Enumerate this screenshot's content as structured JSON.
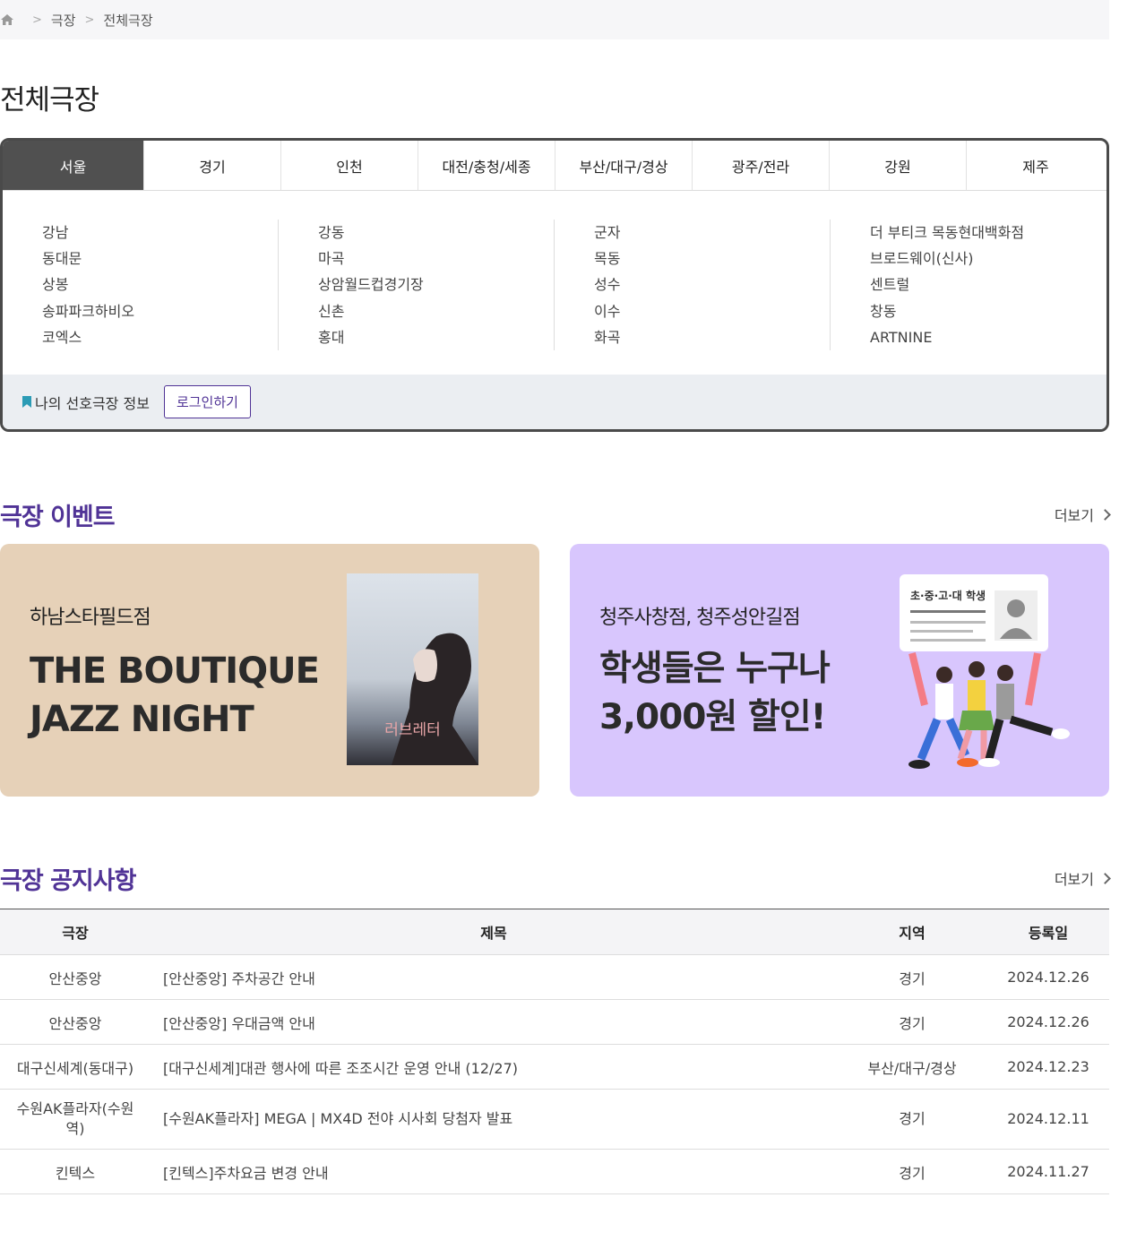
{
  "breadcrumb": {
    "items": [
      "극장",
      "전체극장"
    ]
  },
  "page_title": "전체극장",
  "regions": {
    "tabs": [
      "서울",
      "경기",
      "인천",
      "대전/충청/세종",
      "부산/대구/경상",
      "광주/전라",
      "강원",
      "제주"
    ],
    "active_tab": "서울",
    "branches": [
      [
        "강남",
        "동대문",
        "상봉",
        "송파파크하비오",
        "코엑스"
      ],
      [
        "강동",
        "마곡",
        "상암월드컵경기장",
        "신촌",
        "홍대"
      ],
      [
        "군자",
        "목동",
        "성수",
        "이수",
        "화곡"
      ],
      [
        "더 부티크 목동현대백화점",
        "브로드웨이(신사)",
        "센트럴",
        "창동",
        "ARTNINE"
      ]
    ]
  },
  "favorite": {
    "label": "나의 선호극장 정보",
    "login_button": "로그인하기"
  },
  "events": {
    "title": "극장 이벤트",
    "more": "더보기",
    "cards": [
      {
        "subtitle": "하남스타필드점",
        "headline": "THE BOUTIQUE\nJAZZ NIGHT",
        "poster_title": "러브레터"
      },
      {
        "subtitle": "청주사창점, 청주성안길점",
        "headline": "학생들은 누구나\n3,000원 할인!",
        "card_label": "초·중·고·대 학생"
      }
    ]
  },
  "notices": {
    "title": "극장 공지사항",
    "more": "더보기",
    "columns": [
      "극장",
      "제목",
      "지역",
      "등록일"
    ],
    "rows": [
      {
        "theater": "안산중앙",
        "title": "[안산중앙] 주차공간 안내",
        "region": "경기",
        "date": "2024.12.26"
      },
      {
        "theater": "안산중앙",
        "title": "[안산중앙] 우대금액 안내",
        "region": "경기",
        "date": "2024.12.26"
      },
      {
        "theater": "대구신세계(동대구)",
        "title": "[대구신세계]대관 행사에 따른 조조시간 운영 안내 (12/27)",
        "region": "부산/대구/경상",
        "date": "2024.12.23"
      },
      {
        "theater": "수원AK플라자(수원역)",
        "title": "[수원AK플라자] MEGA | MX4D 전야 시사회 당첨자 발표",
        "region": "경기",
        "date": "2024.12.11"
      },
      {
        "theater": "킨텍스",
        "title": "[킨텍스]주차요금 변경 안내",
        "region": "경기",
        "date": "2024.11.27"
      }
    ]
  }
}
